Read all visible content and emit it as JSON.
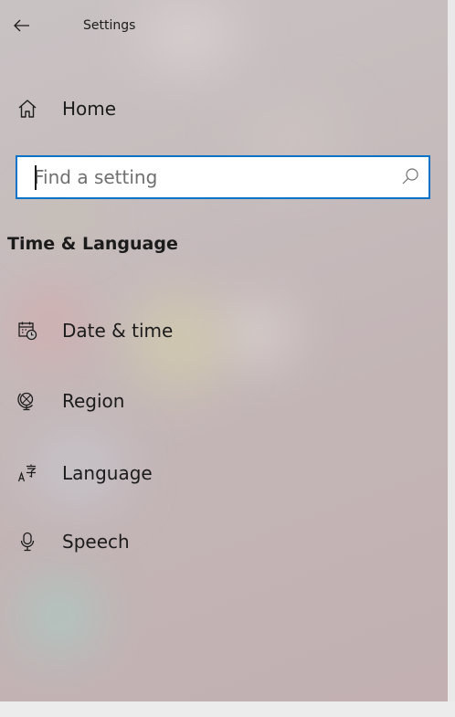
{
  "window": {
    "title": "Settings",
    "accent_color": "#0a72c7"
  },
  "nav": {
    "back_icon": "arrow-left-icon",
    "home_label": "Home",
    "home_icon": "home-icon"
  },
  "search": {
    "placeholder": "Find a setting",
    "value": "",
    "icon": "search-icon"
  },
  "section": {
    "title": "Time & Language",
    "items": [
      {
        "label": "Date & time",
        "icon": "calendar-clock-icon"
      },
      {
        "label": "Region",
        "icon": "globe-region-icon"
      },
      {
        "label": "Language",
        "icon": "language-icon"
      },
      {
        "label": "Speech",
        "icon": "microphone-icon"
      }
    ]
  }
}
